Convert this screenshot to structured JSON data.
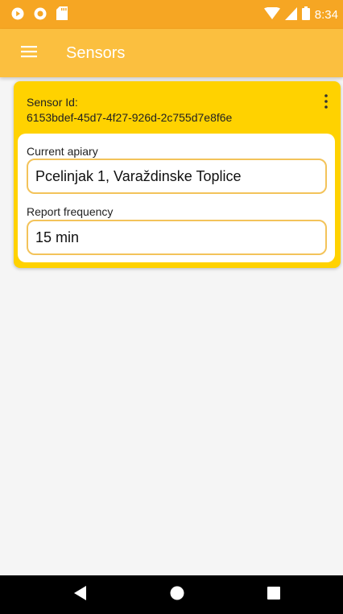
{
  "status_bar": {
    "time": "8:34"
  },
  "app_bar": {
    "title": "Sensors"
  },
  "sensor_card": {
    "id_label": "Sensor Id:",
    "id_value": "6153bdef-45d7-4f27-926d-2c755d7e8f6e",
    "fields": [
      {
        "label": "Current apiary",
        "value": "Pcelinjak 1, Varaždinske Toplice"
      },
      {
        "label": "Report frequency",
        "value": "15 min"
      }
    ]
  },
  "colors": {
    "status_bar": "#f6a623",
    "app_bar": "#fbbf3f",
    "card": "#ffd200",
    "field_border": "#f3c35a"
  },
  "icons": {
    "menu": "hamburger-menu-icon",
    "more": "more-vertical-icon",
    "back": "back-triangle-icon",
    "home": "home-circle-icon",
    "recents": "recents-square-icon"
  }
}
